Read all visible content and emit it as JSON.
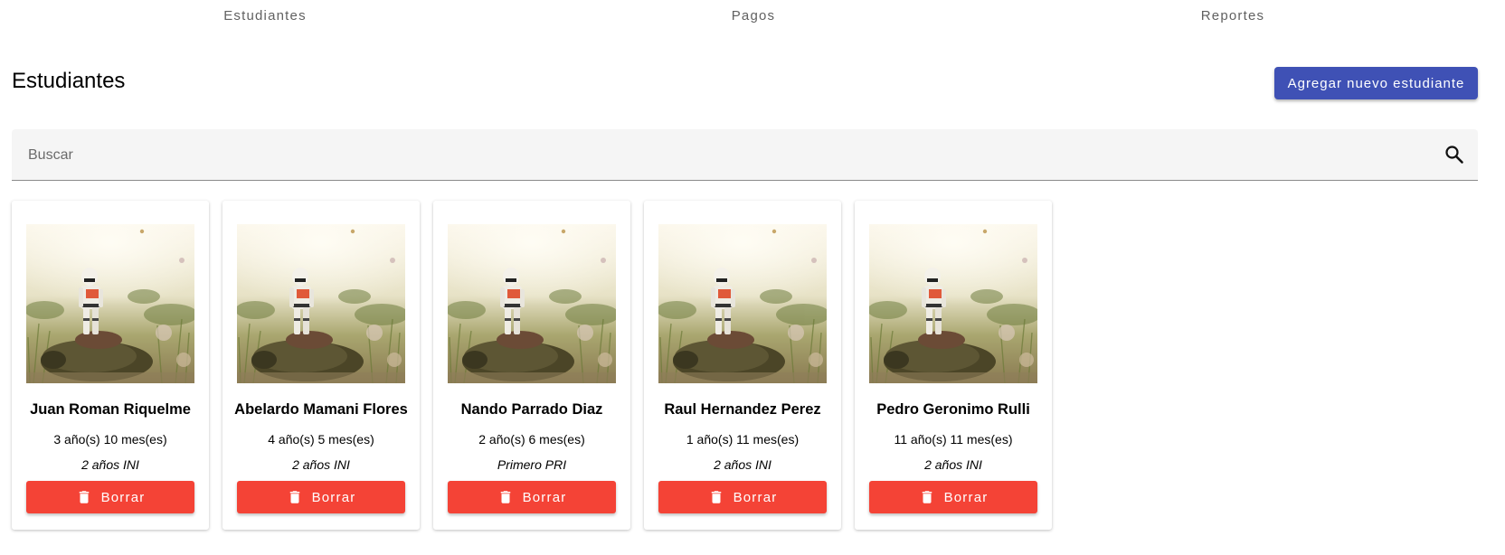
{
  "nav": {
    "tabs": [
      {
        "label": "Estudiantes"
      },
      {
        "label": "Pagos"
      },
      {
        "label": "Reportes"
      }
    ]
  },
  "header": {
    "title": "Estudiantes",
    "add_button_label": "Agregar nuevo estudiante"
  },
  "search": {
    "placeholder": "Buscar",
    "value": "",
    "icon": "search-icon"
  },
  "students": [
    {
      "name": "Juan Roman Riquelme",
      "age": "3 año(s) 10 mes(es)",
      "level": "2 años INI",
      "delete_label": "Borrar"
    },
    {
      "name": "Abelardo Mamani Flores",
      "age": "4 año(s) 5 mes(es)",
      "level": "2 años INI",
      "delete_label": "Borrar"
    },
    {
      "name": "Nando Parrado Diaz",
      "age": "2 año(s) 6 mes(es)",
      "level": "Primero PRI",
      "delete_label": "Borrar"
    },
    {
      "name": "Raul Hernandez Perez",
      "age": "1 año(s) 11 mes(es)",
      "level": "2 años INI",
      "delete_label": "Borrar"
    },
    {
      "name": "Pedro Geronimo Rulli",
      "age": "11 año(s) 11 mes(es)",
      "level": "2 años INI",
      "delete_label": "Borrar"
    }
  ],
  "colors": {
    "primary": "#3f51b5",
    "danger": "#f44336",
    "tab_text": "#616161",
    "search_bg": "#f5f5f5"
  }
}
